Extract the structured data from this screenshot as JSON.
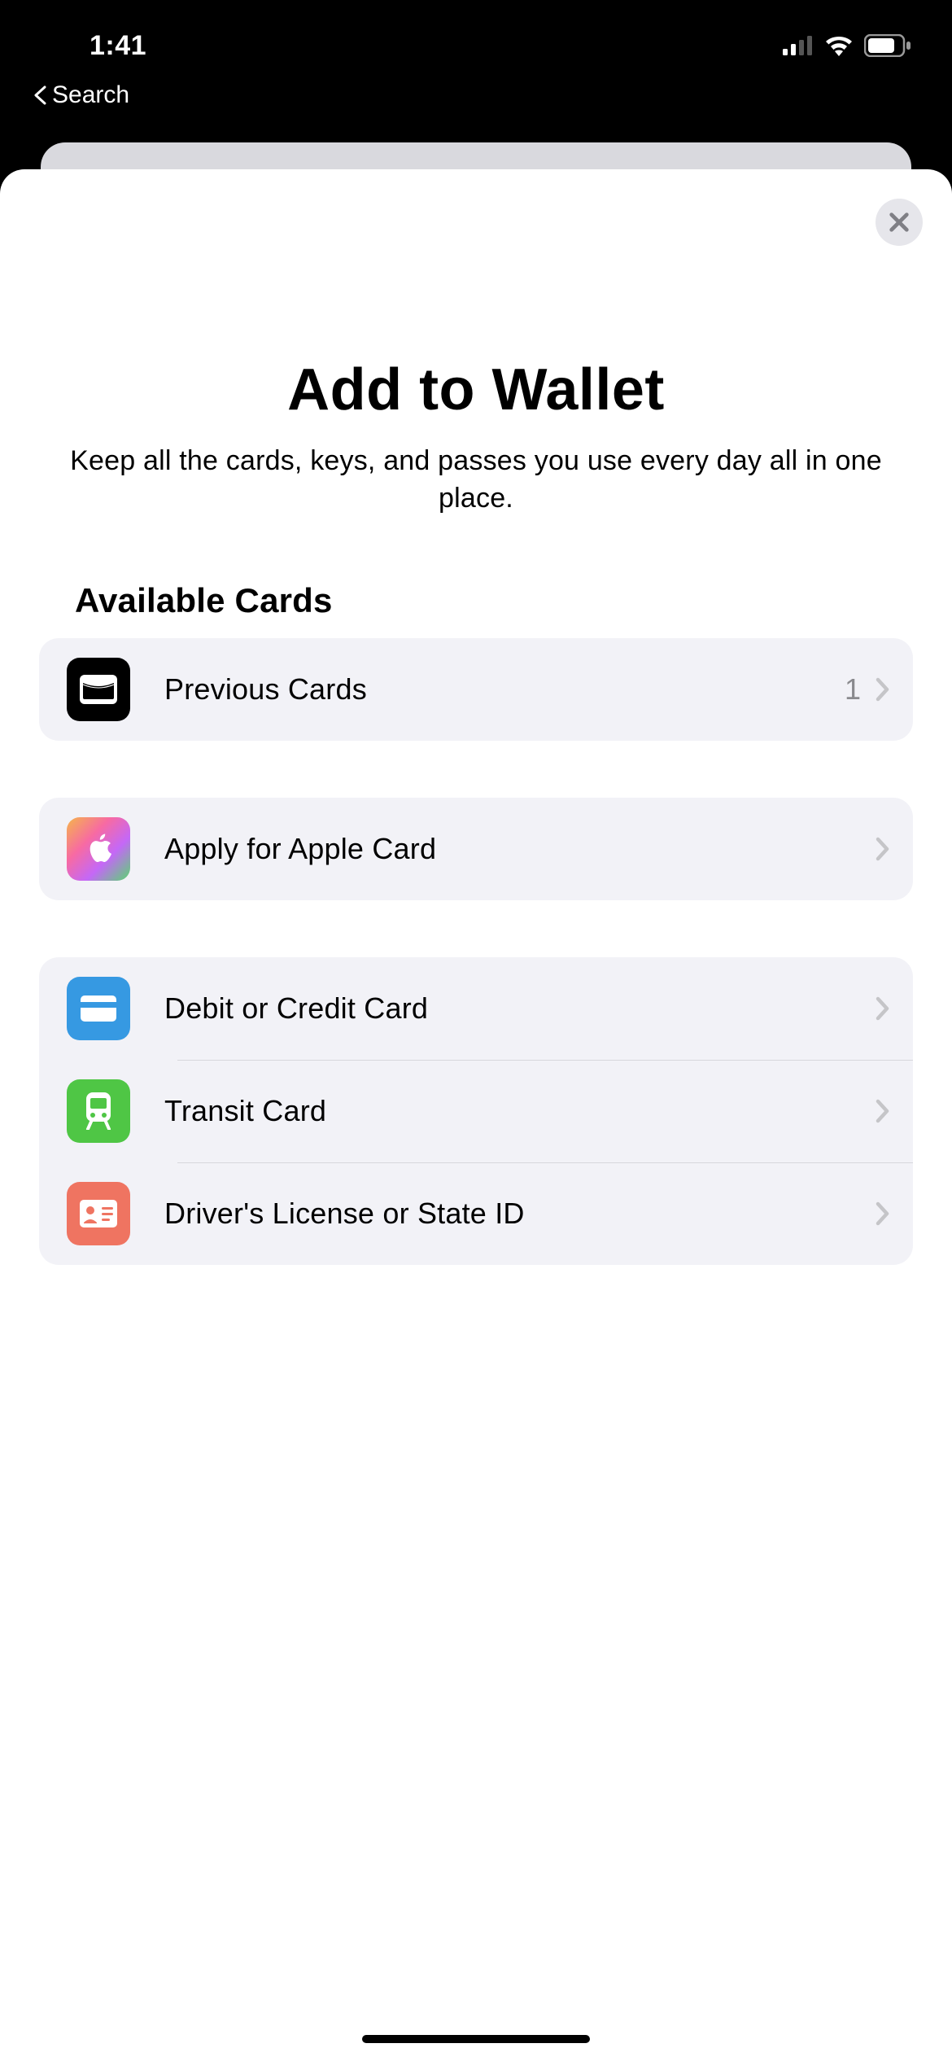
{
  "status": {
    "time": "1:41",
    "back_label": "Search"
  },
  "modal": {
    "title": "Add to Wallet",
    "subtitle": "Keep all the cards, keys, and passes you use every day all in one place.",
    "section_title": "Available Cards",
    "groups": [
      {
        "rows": [
          {
            "label": "Previous Cards",
            "badge": "1",
            "icon": "wallet-icon",
            "color": "black"
          }
        ]
      },
      {
        "rows": [
          {
            "label": "Apply for Apple Card",
            "icon": "apple-logo-icon",
            "color": "gradient"
          }
        ]
      },
      {
        "rows": [
          {
            "label": "Debit or Credit Card",
            "icon": "credit-card-icon",
            "color": "blue"
          },
          {
            "label": "Transit Card",
            "icon": "transit-icon",
            "color": "green"
          },
          {
            "label": "Driver's License or State ID",
            "icon": "id-card-icon",
            "color": "red"
          }
        ]
      }
    ]
  }
}
